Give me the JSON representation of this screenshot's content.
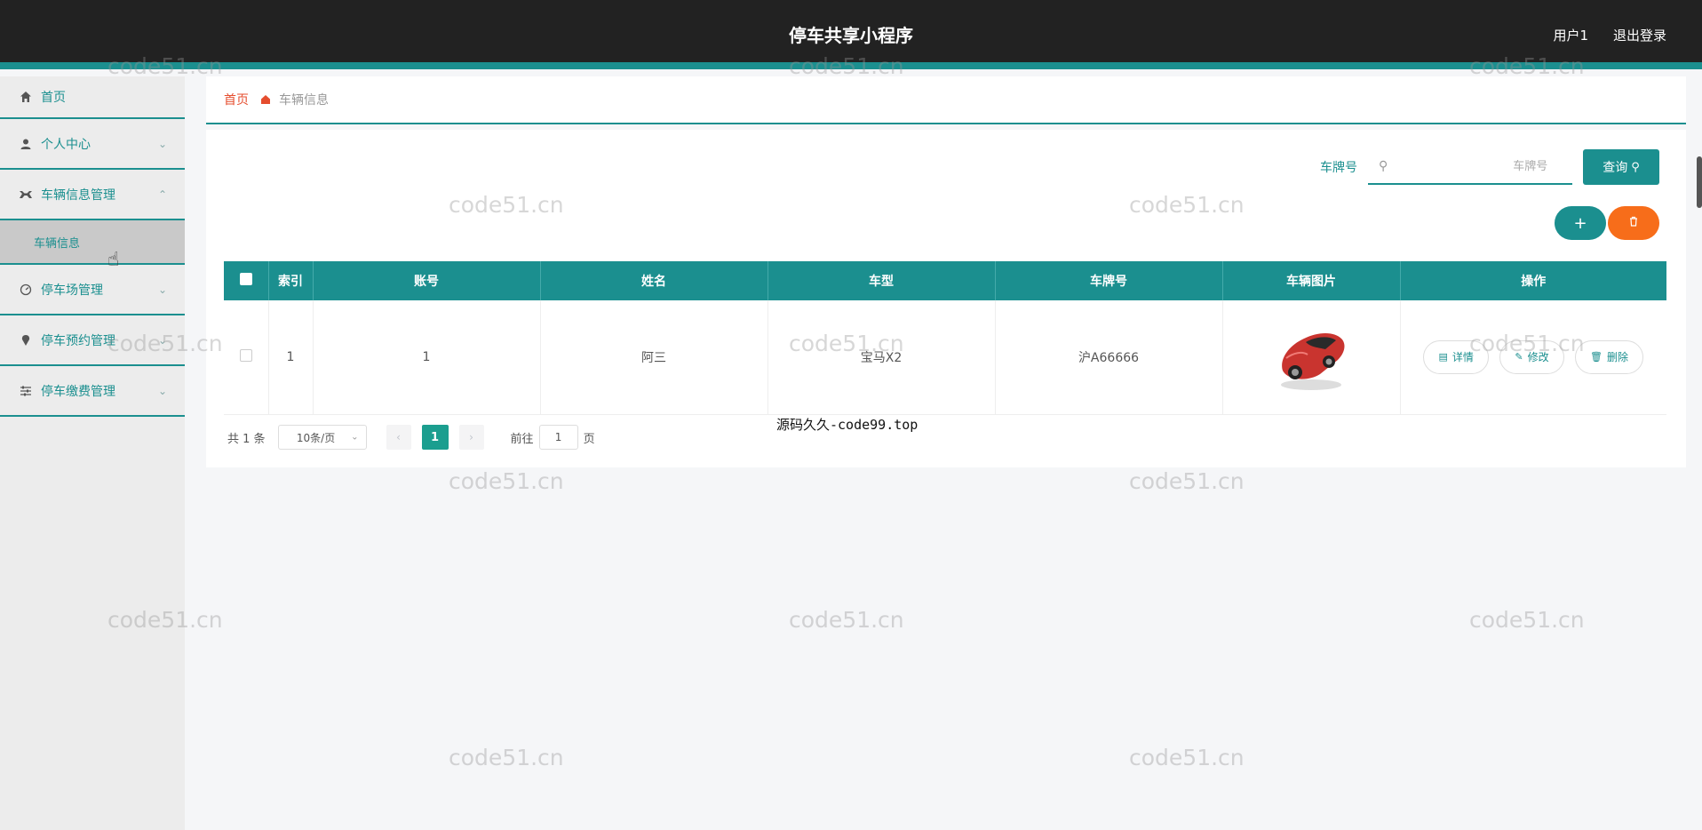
{
  "header": {
    "title": "停车共享小程序",
    "user": "用户1",
    "logout": "退出登录"
  },
  "sidebar": {
    "items": [
      {
        "label": "首页",
        "icon": "home-icon"
      },
      {
        "label": "个人中心",
        "icon": "user-icon"
      },
      {
        "label": "车辆信息管理",
        "icon": "car-icon",
        "expanded": true,
        "sub": [
          {
            "label": "车辆信息"
          }
        ]
      },
      {
        "label": "停车场管理",
        "icon": "gauge-icon"
      },
      {
        "label": "停车预约管理",
        "icon": "pin-icon"
      },
      {
        "label": "停车缴费管理",
        "icon": "sliders-icon"
      }
    ]
  },
  "breadcrumb": {
    "home": "首页",
    "current": "车辆信息"
  },
  "search": {
    "label": "车牌号",
    "placeholder": "车牌号",
    "button": "查询"
  },
  "actions": {
    "add": "+",
    "delete_icon": "trash-icon"
  },
  "table": {
    "headers": [
      "索引",
      "账号",
      "姓名",
      "车型",
      "车牌号",
      "车辆图片",
      "操作"
    ],
    "rows": [
      {
        "index": "1",
        "account": "1",
        "name": "阿三",
        "model": "宝马X2",
        "plate": "沪A66666"
      }
    ],
    "ops": {
      "detail": "详情",
      "edit": "修改",
      "delete": "删除"
    }
  },
  "pagination": {
    "total": "共 1 条",
    "size": "10条/页",
    "current": "1",
    "goto": "前往",
    "goto_value": "1",
    "page_suffix": "页"
  },
  "overlay": "源码久久-code99.top",
  "watermark": "code51.cn",
  "colors": {
    "accent": "#1b8f8f",
    "danger": "#f76d1a",
    "header_bg": "#222222"
  }
}
